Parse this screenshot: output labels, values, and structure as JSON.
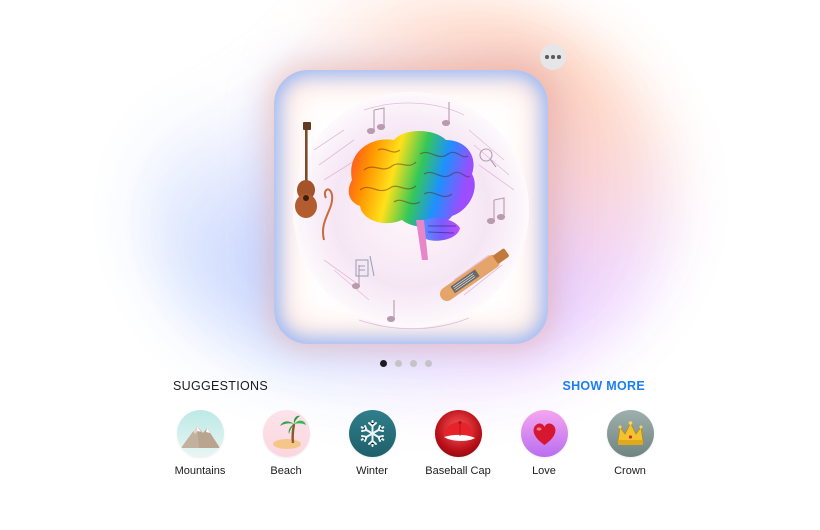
{
  "card": {
    "image_name": "brain-music-illustration"
  },
  "pager": {
    "count": 4,
    "active_index": 0
  },
  "suggestions": {
    "title": "SUGGESTIONS",
    "show_more_label": "SHOW MORE",
    "items": [
      {
        "label": "Mountains",
        "icon": "mountain-icon"
      },
      {
        "label": "Beach",
        "icon": "palm-tree-icon"
      },
      {
        "label": "Winter",
        "icon": "snowflake-icon"
      },
      {
        "label": "Baseball Cap",
        "icon": "baseball-cap-icon"
      },
      {
        "label": "Love",
        "icon": "heart-icon"
      },
      {
        "label": "Crown",
        "icon": "crown-icon"
      }
    ]
  },
  "colors": {
    "accent": "#1a7ff0",
    "text": "#1c1c1e",
    "pager_active": "#1c1c1e",
    "pager_inactive": "#c4c4c7"
  }
}
